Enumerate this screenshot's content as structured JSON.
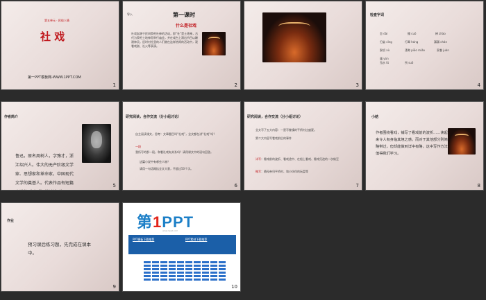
{
  "slides": [
    {
      "num": "1",
      "unit": "第五单元 · 民俗人情",
      "title": "社  戏",
      "footer": "第一PPT模板网-WWW.1PPT.COM"
    },
    {
      "num": "2",
      "tag": "导入",
      "heading": "第一课时",
      "sub": "什么是社戏",
      "body": "社戏起源于民间祭祀社神的活动，即“社”是土地神，古代为祭祀土地神而举行庙会，并在戏台上演出节目以酬谢神灵。旧时村社里的人们就在这样热闹的活动中，观看戏剧、社火等表演。"
    },
    {
      "num": "3"
    },
    {
      "num": "4",
      "tag": "检查字词",
      "words": [
        "怠 dài",
        "撮 cuō",
        "棹 zhào",
        "归省 xǐng",
        "行辈 háng",
        "潺潺 chán",
        "絮叨 xù",
        "漂渺 piāo miǎo",
        "家眷 juàn",
        "蕴 yùn",
        "凫水 fú",
        "所 suǒ"
      ]
    },
    {
      "num": "5",
      "tag": "作者简介",
      "bio": "鲁迅，原名周树人，字豫才，浙江绍兴人。伟大的无产阶级文学家、思想家和革命家，中国现代文学的奠基人。代表作品有短篇小说集《呐喊》《彷徨》等。"
    },
    {
      "num": "6",
      "tag": "研究阅读，合作交流（分小组讨论）",
      "q1": "自主阅读课文，思考：文章题目叫“社戏”，全文都在讲“社戏”吗？",
      "label": "一段",
      "q2": "我所写的那一段，和看社戏有关系吗？请用课文中的语句回答。",
      "q3": "这篇小说中有哪些人物？",
      "q4": "请用一句话概括全文大意，不超过50个字。"
    },
    {
      "num": "7",
      "tag": "研究阅读，合作交流（分小组讨论）",
      "p1": "全文写了五大内容：一是写鲁镇的平桥村过盛夏。",
      "p2": "第二大内容写看戏前后的事件",
      "hl1": "详写",
      "p3": "：看戏前的波折、看戏途中、在船上看戏、看戏归途的一次偷豆",
      "hl2": "略写",
      "p4": "：随母亲归平桥村、和小伙伴的玩耍等"
    },
    {
      "num": "8",
      "tag": "小结",
      "summary": "作者围绕看戏，铺写了看戏前的波折……读起来令人有身临其境之感。而对于其他部分则简略带过，但却能做到详中有略，这中写作方法值得我们学习。"
    },
    {
      "num": "9",
      "tag": "作业",
      "hw": "预习课后练习题，先完成在课本中。"
    },
    {
      "num": "10",
      "logo_a": "第",
      "logo_b": "1",
      "logo_c": "PPT",
      "logo_sub": "www.1ppt.com",
      "b1": "PPT模板下载推荐",
      "b2": "PPT素材下载推荐"
    }
  ]
}
